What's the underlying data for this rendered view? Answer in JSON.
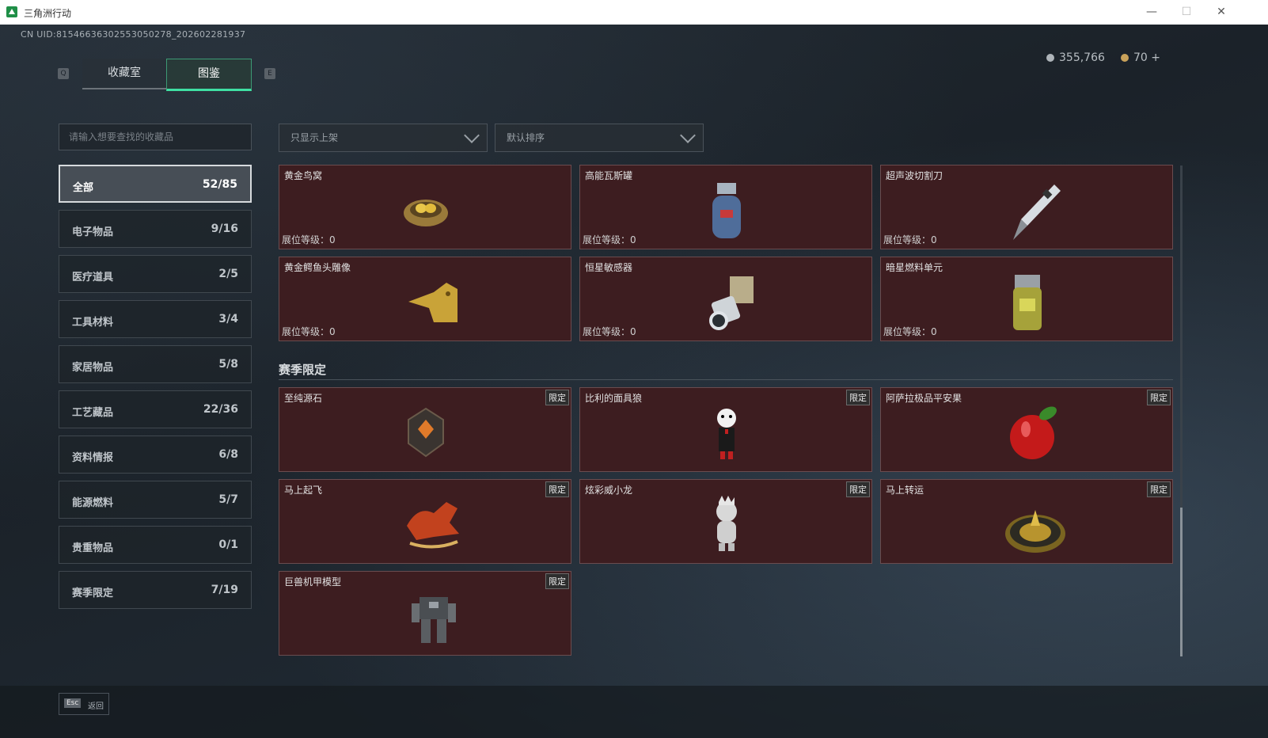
{
  "window": {
    "title": "三角洲行动",
    "minimize": "—",
    "maximize": "☐",
    "close": "✕"
  },
  "uid": "CN UID:81546636302553050278_202602281937",
  "hotkeys": {
    "left": "Q",
    "right": "E"
  },
  "tabs": [
    {
      "label": "收藏室",
      "active": false
    },
    {
      "label": "图鉴",
      "active": true
    }
  ],
  "currency": {
    "silver": "355,766",
    "gold": "70",
    "gold_plus": "+"
  },
  "search": {
    "placeholder": "请输入想要查找的收藏品"
  },
  "filters": {
    "show": "只显示上架",
    "sort": "默认排序"
  },
  "categories": [
    {
      "name": "全部",
      "count": "52/85",
      "active": true
    },
    {
      "name": "电子物品",
      "count": "9/16"
    },
    {
      "name": "医疗道具",
      "count": "2/5"
    },
    {
      "name": "工具材料",
      "count": "3/4"
    },
    {
      "name": "家居物品",
      "count": "5/8"
    },
    {
      "name": "工艺藏品",
      "count": "22/36"
    },
    {
      "name": "资料情报",
      "count": "6/8"
    },
    {
      "name": "能源燃料",
      "count": "5/7"
    },
    {
      "name": "贵重物品",
      "count": "0/1"
    },
    {
      "name": "赛季限定",
      "count": "7/19"
    }
  ],
  "items": [
    {
      "name": "黄金鸟窝",
      "level": "展位等级：0",
      "icon": "golden-nest-icon"
    },
    {
      "name": "高能瓦斯罐",
      "level": "展位等级：0",
      "icon": "gas-canister-icon"
    },
    {
      "name": "超声波切割刀",
      "level": "展位等级：0",
      "icon": "ultrasonic-knife-icon"
    },
    {
      "name": "黄金鳄鱼头雕像",
      "level": "展位等级：0",
      "icon": "gold-crocodile-statue-icon"
    },
    {
      "name": "恒星敏感器",
      "level": "展位等级：0",
      "icon": "star-sensor-icon"
    },
    {
      "name": "暗星燃料单元",
      "level": "展位等级：0",
      "icon": "fuel-cell-icon"
    }
  ],
  "season_section": {
    "title": "赛季限定"
  },
  "limited_tag": "限定",
  "season_items": [
    {
      "name": "至纯源石",
      "icon": "source-stone-icon"
    },
    {
      "name": "比利的面具狼",
      "icon": "billy-puppet-icon"
    },
    {
      "name": "阿萨拉极品平安果",
      "icon": "red-apple-icon"
    },
    {
      "name": "马上起飞",
      "icon": "red-horse-icon"
    },
    {
      "name": "炫彩威小龙",
      "icon": "silver-dragon-figure-icon"
    },
    {
      "name": "马上转运",
      "icon": "gold-compass-icon"
    },
    {
      "name": "巨兽机甲模型",
      "icon": "mech-model-icon"
    }
  ],
  "footer": {
    "esc_key": "Esc",
    "esc_label": "返回"
  },
  "colors": {
    "card_bg": "#3d1d20",
    "tab_accent": "#3fe0a3",
    "background": "#1c232b"
  }
}
